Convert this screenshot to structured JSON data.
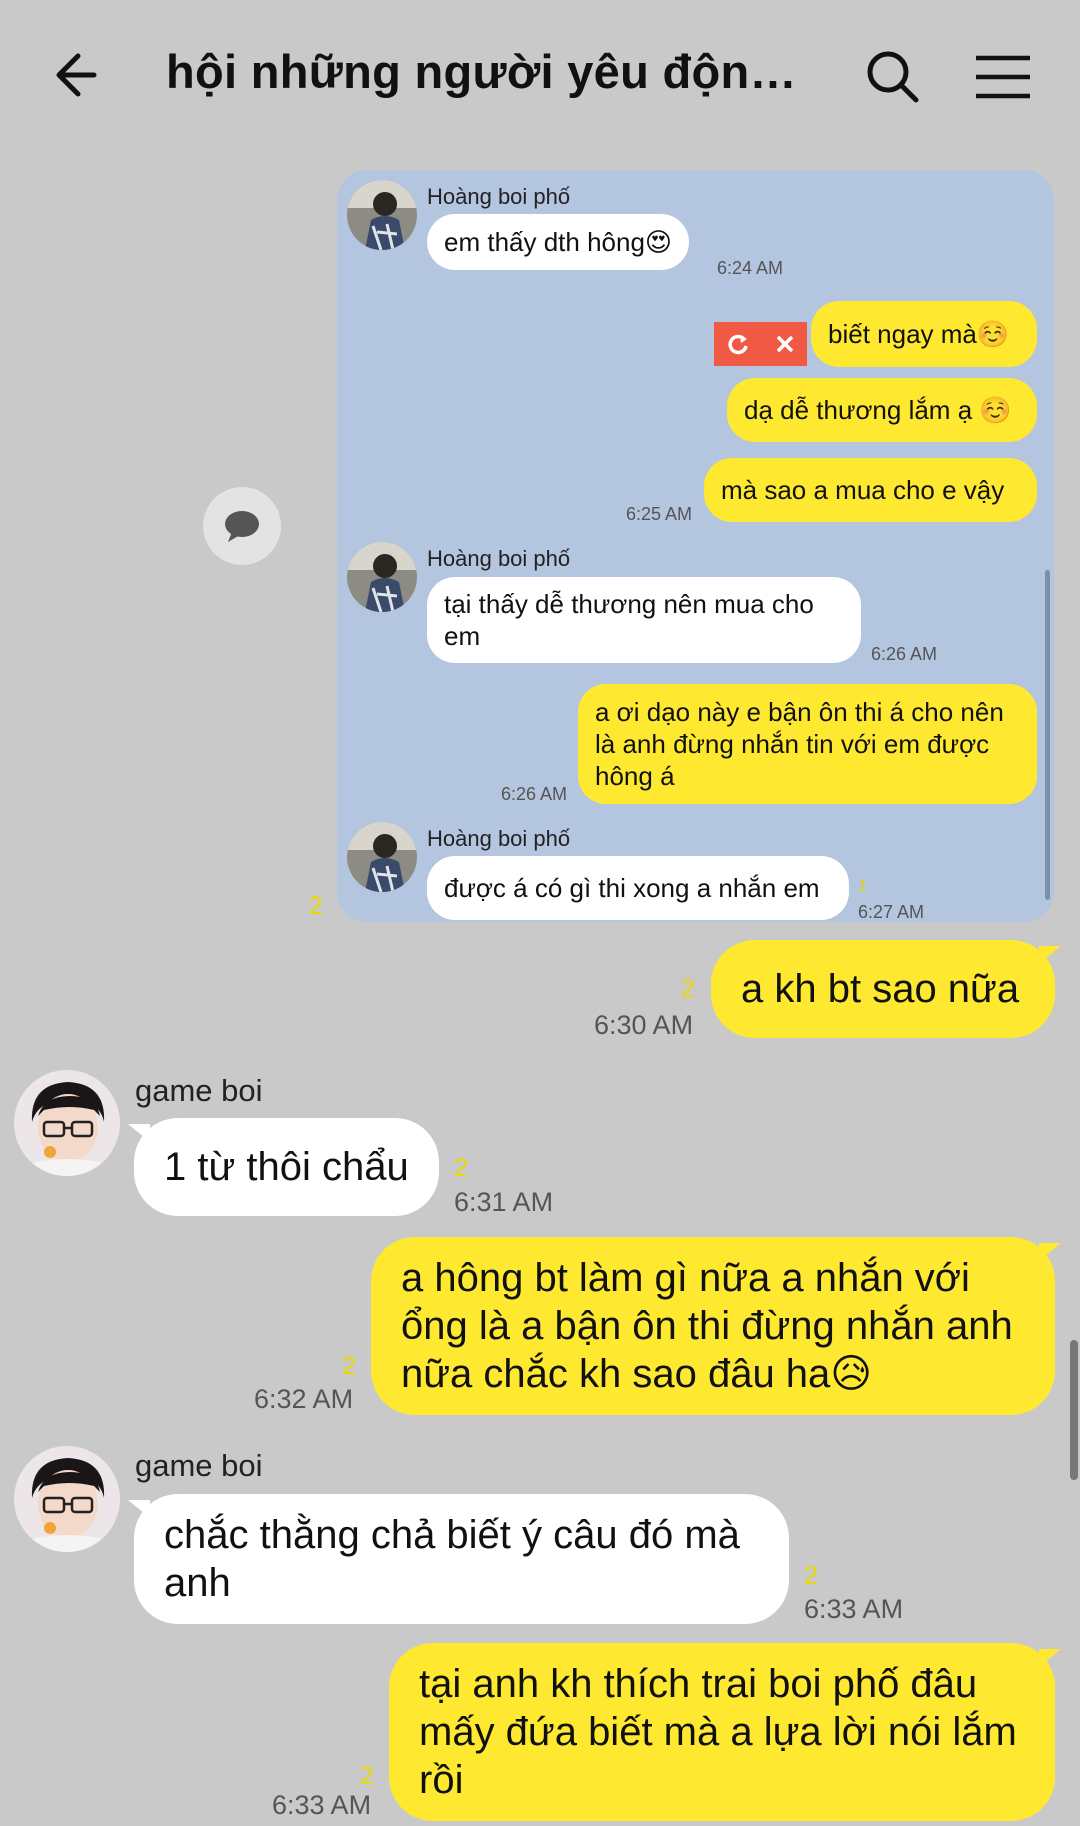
{
  "header": {
    "title": "hội những người yêu động..."
  },
  "screenshot": {
    "messages": [
      {
        "sender": "Hoàng boi phố",
        "text": "em thấy dth hông😍",
        "time": "6:24 AM"
      },
      {
        "text": "biết ngay mà☺️"
      },
      {
        "text": "dạ dễ thương lắm ạ ☺️"
      },
      {
        "text": "mà sao a mua cho e vậy",
        "time": "6:25 AM"
      },
      {
        "sender": "Hoàng boi phố",
        "text": "tại thấy dễ thương nên mua cho em",
        "time": "6:26 AM"
      },
      {
        "text": "a ơi dạo này e bận ôn thi á cho nên là anh đừng nhắn tin với em được hông á",
        "time": "6:26 AM"
      },
      {
        "sender": "Hoàng boi phố",
        "text": "được á có gì thi xong a nhắn em",
        "read": "1",
        "time": "6:27 AM"
      }
    ],
    "read_outside": "2"
  },
  "chat": {
    "messages": [
      {
        "side": "right",
        "text": "a kh bt sao nữa",
        "read": "2",
        "time": "6:30 AM"
      },
      {
        "side": "left",
        "sender": "game boi",
        "text": "1 từ thôi chẩu",
        "read": "2",
        "time": "6:31 AM"
      },
      {
        "side": "right",
        "text": "a hông bt làm gì nữa a nhắn với ổng là a bận ôn thi đừng nhắn anh nữa chắc kh sao đâu ha😥",
        "read": "2",
        "time": "6:32 AM"
      },
      {
        "side": "left",
        "sender": "game boi",
        "text": "chắc thằng chả biết ý câu đó mà anh",
        "read": "2",
        "time": "6:33 AM"
      },
      {
        "side": "right",
        "text": "tại anh kh thích trai boi phố đâu mấy đứa biết mà a lựa lời nói lắm rồi",
        "read": "2",
        "time": "6:33 AM"
      }
    ]
  },
  "icons": {
    "back": "arrow-left-icon",
    "search": "search-icon",
    "menu": "hamburger-menu-icon",
    "retry": "retry-icon",
    "delete": "close-icon",
    "float": "chat-bubble-icon"
  },
  "colors": {
    "background": "#c9c9c9",
    "my_bubble": "#fee930",
    "other_bubble": "#ffffff",
    "screenshot_background": "#b3c5df",
    "error_badge": "#f05a45"
  }
}
